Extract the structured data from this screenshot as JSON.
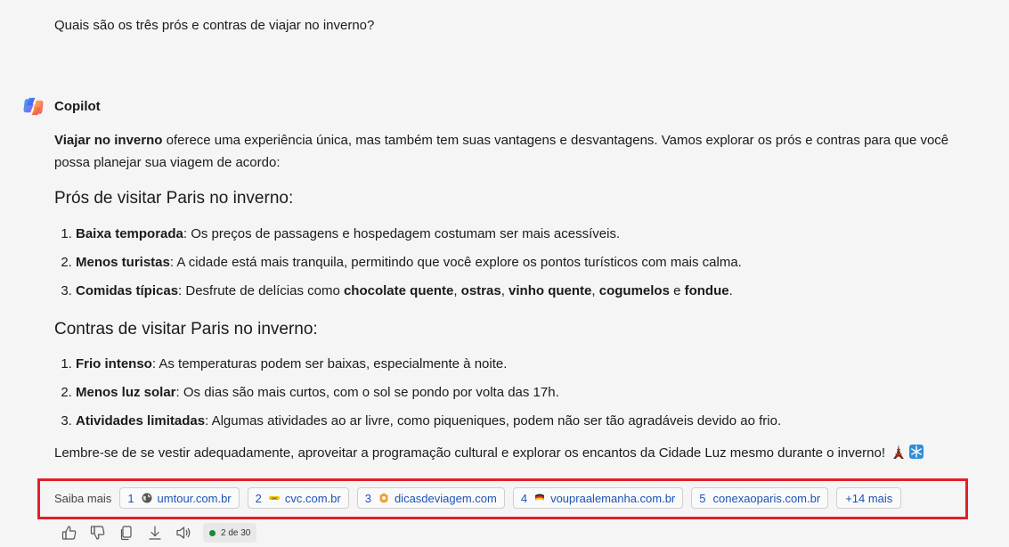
{
  "conversation": {
    "user_question": "Quais são os três prós e contras de viajar no inverno?",
    "assistant_name": "Copilot"
  },
  "answer": {
    "intro_bold": "Viajar no inverno",
    "intro_rest_line1": " oferece uma experiência única, mas também tem suas vantagens e desvantagens. Vamos explorar os prós e contras para que você",
    "intro_rest_line2": "possa planejar sua viagem de acordo:",
    "pros_heading": "Prós de visitar Paris no inverno:",
    "pros": [
      {
        "term": "Baixa temporada",
        "text": ": Os preços de passagens e hospedagem costumam ser mais acessíveis."
      },
      {
        "term": "Menos turistas",
        "text": ": A cidade está mais tranquila, permitindo que você explore os pontos turísticos com mais calma."
      },
      {
        "term": "Comidas típicas",
        "text": ": Desfrute de delícias como "
      }
    ],
    "pros_3_rest": {
      "b1": "chocolate quente",
      "s1": ", ",
      "b2": "ostras",
      "s2": ", ",
      "b3": "vinho quente",
      "s3": ", ",
      "b4": "cogumelos",
      "s4": " e ",
      "b5": "fondue",
      "s5": "."
    },
    "cons_heading": "Contras de visitar Paris no inverno:",
    "cons": [
      {
        "term": "Frio intenso",
        "text": ": As temperaturas podem ser baixas, especialmente à noite."
      },
      {
        "term": "Menos luz solar",
        "text": ": Os dias são mais curtos, com o sol se pondo por volta das 17h."
      },
      {
        "term": "Atividades limitadas",
        "text": ": Algumas atividades ao ar livre, como piqueniques, podem não ser tão agradáveis devido ao frio."
      }
    ],
    "outro": "Lembre-se de se vestir adequadamente, aproveitar a programação cultural e explorar os encantos da Cidade Luz mesmo durante o inverno!",
    "outro_icons": [
      "eiffel-tower-icon",
      "snowflake-icon"
    ]
  },
  "sources": {
    "label": "Saiba mais",
    "items": [
      {
        "num": "1",
        "domain": "umtour.com.br",
        "icon": "globe-icon"
      },
      {
        "num": "2",
        "domain": "cvc.com.br",
        "icon": "cvc-logo-icon"
      },
      {
        "num": "3",
        "domain": "dicasdeviagem.com",
        "icon": "dicasdeviagem-logo-icon"
      },
      {
        "num": "4",
        "domain": "voupraalemanha.com.br",
        "icon": "germany-flag-icon"
      },
      {
        "num": "5",
        "domain": "conexaoparis.com.br",
        "icon": "conexaoparis-logo-icon"
      }
    ],
    "more_label": "+14 mais"
  },
  "toolbar": {
    "icons": [
      "thumbs-up-icon",
      "thumbs-down-icon",
      "copy-icon",
      "download-icon",
      "speaker-icon"
    ],
    "response_count": "2 de 30",
    "status_color": "#138a36"
  },
  "colors": {
    "highlight_frame": "#e3202a",
    "link": "#1d54b6",
    "background": "#f5f5f5"
  }
}
